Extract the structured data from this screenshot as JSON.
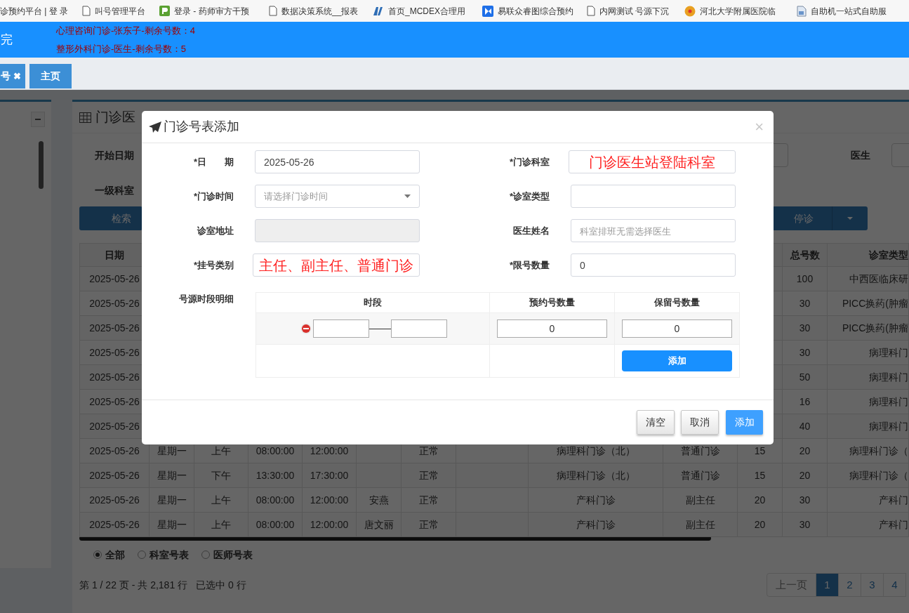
{
  "bookmarks": [
    {
      "label": "诊预约平台 | 登 录",
      "kind": "none"
    },
    {
      "label": "叫号管理平台",
      "kind": "page"
    },
    {
      "label": "登录 - 药师审方干预",
      "kind": "green"
    },
    {
      "label": "数据决策系统__报表",
      "kind": "page"
    },
    {
      "label": "首页_MCDEX合理用",
      "kind": "mlogo"
    },
    {
      "label": "易联众睿图综合预约",
      "kind": "blue"
    },
    {
      "label": "内网测试 号源下沉",
      "kind": "page"
    },
    {
      "label": "河北大学附属医院临",
      "kind": "circle"
    },
    {
      "label": "自助机一站式自助服",
      "kind": "imagepage"
    }
  ],
  "header": {
    "title": "完",
    "notices": [
      "心理咨询门诊-张东子-剩余号数：4",
      "整形外科门诊-医生-剩余号数：5"
    ]
  },
  "tabs": [
    {
      "label": "号",
      "close": "✖"
    },
    {
      "label": "主页"
    }
  ],
  "panel": {
    "title": "门诊医",
    "filters": [
      {
        "label": "开始日期"
      },
      {
        "label": "医生"
      },
      {
        "label": "一级科室"
      }
    ],
    "buttons": [
      {
        "label": "检索"
      },
      {
        "label": "停诊"
      }
    ],
    "table": {
      "headers": {
        "date": "日期",
        "total": "总号数",
        "room_type": "诊室类型"
      },
      "rows": [
        {
          "date": "2025-05-26",
          "total": "100",
          "room_type": "中西医临床研"
        },
        {
          "date": "2025-05-26",
          "total": "30",
          "room_type": "PICC换药(肿瘤"
        },
        {
          "date": "2025-05-26",
          "total": "30",
          "room_type": "PICC换药(肿瘤"
        },
        {
          "date": "2025-05-26",
          "total": "30",
          "room_type": "病理科门"
        },
        {
          "date": "2025-05-26",
          "total": "50",
          "room_type": "病理科门"
        },
        {
          "date": "2025-05-26",
          "total": "16",
          "room_type": "病理科门"
        },
        {
          "date": "2025-05-26",
          "total": "40",
          "room_type": "病理科门"
        },
        {
          "date": "2025-05-26",
          "column_2": "星期一",
          "column_3": "上午",
          "column_4": "08:00:00",
          "column_5": "12:00:00",
          "column_7": "正常",
          "column_9": "病理科门诊（北）",
          "column_10": "普通门诊",
          "column_11": "15",
          "total": "20",
          "room_type": "病理科门诊（"
        },
        {
          "date": "2025-05-26",
          "column_2": "星期一",
          "column_3": "下午",
          "column_4": "13:30:00",
          "column_5": "17:30:00",
          "column_7": "正常",
          "column_9": "病理科门诊（北）",
          "column_10": "普通门诊",
          "column_11": "15",
          "total": "20",
          "room_type": "病理科门诊（"
        },
        {
          "date": "2025-05-26",
          "column_2": "星期一",
          "column_3": "上午",
          "column_4": "08:00:00",
          "column_5": "12:00:00",
          "column_6": "安燕",
          "column_7": "正常",
          "column_9": "产科门诊",
          "column_10": "副主任",
          "column_11": "20",
          "total": "30",
          "room_type": "产科门"
        },
        {
          "date": "2025-05-26",
          "column_2": "星期一",
          "column_3": "上午",
          "column_4": "08:00:00",
          "column_5": "12:00:00",
          "column_6": "唐文丽",
          "column_7": "正常",
          "column_9": "产科门诊",
          "column_10": "副主任",
          "column_11": "20",
          "total": "30",
          "room_type": "产科门"
        }
      ]
    },
    "view_options": [
      {
        "label": "全部",
        "selected": true
      },
      {
        "label": "科室号表",
        "selected": false
      },
      {
        "label": "医师号表",
        "selected": false
      }
    ],
    "summary": "第 1 / 22 页 - 共 2,181 行",
    "selection": "已选中 0 行",
    "pagination": [
      {
        "label": "上一页",
        "selected": false
      },
      {
        "label": "1",
        "selected": true
      },
      {
        "label": "2",
        "selected": false
      },
      {
        "label": "3",
        "selected": false
      },
      {
        "label": "4",
        "selected": false
      }
    ]
  },
  "dialog": {
    "title": "门诊号表添加",
    "close": "×",
    "fields": [
      {
        "label": "*日　　期",
        "kind": "text",
        "value": "2025-05-26"
      },
      {
        "label": "*门诊科室",
        "kind": "note",
        "value": "门诊医生站登陆科室"
      },
      {
        "label": "*门诊时间",
        "kind": "select",
        "placeholder": "请选择门诊时间"
      },
      {
        "label": "*诊室类型",
        "kind": "text"
      },
      {
        "label": "诊室地址",
        "kind": "readonly"
      },
      {
        "label": "医生姓名",
        "kind": "text",
        "placeholder": "科室排班无需选择医生"
      },
      {
        "label": "*挂号类别",
        "kind": "note",
        "value": "主任、副主任、普通门诊"
      },
      {
        "label": "*限号数量",
        "kind": "text",
        "value": "0"
      }
    ],
    "detail": {
      "label": "号源时段明细",
      "columns": [
        "时段",
        "预约号数量",
        "保留号数量"
      ],
      "rows": [
        {
          "booked": "0",
          "reserved": "0"
        }
      ],
      "add_button": "添加"
    },
    "buttons": [
      {
        "label": "清空",
        "kind": "default"
      },
      {
        "label": "取消",
        "kind": "default"
      },
      {
        "label": "添加",
        "kind": "primary"
      }
    ]
  }
}
